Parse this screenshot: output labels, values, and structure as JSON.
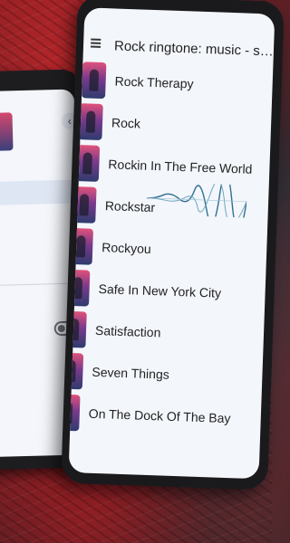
{
  "back_screen": {
    "chevron_icon": "chevron-left-icon"
  },
  "front_screen": {
    "app_title": "Rock ringtone: music - s…",
    "songs": [
      {
        "title": "Rock Therapy"
      },
      {
        "title": "Rock"
      },
      {
        "title": "Rockin In The Free World"
      },
      {
        "title": "Rockstar"
      },
      {
        "title": "Rockyou"
      },
      {
        "title": "Safe In New York City"
      },
      {
        "title": "Satisfaction"
      },
      {
        "title": "Seven Things"
      },
      {
        "title": "On The Dock Of The Bay"
      }
    ],
    "playing_index": 3
  },
  "colors": {
    "screen_bg": "#f3f6fb",
    "wave": "#2f6f8f"
  }
}
